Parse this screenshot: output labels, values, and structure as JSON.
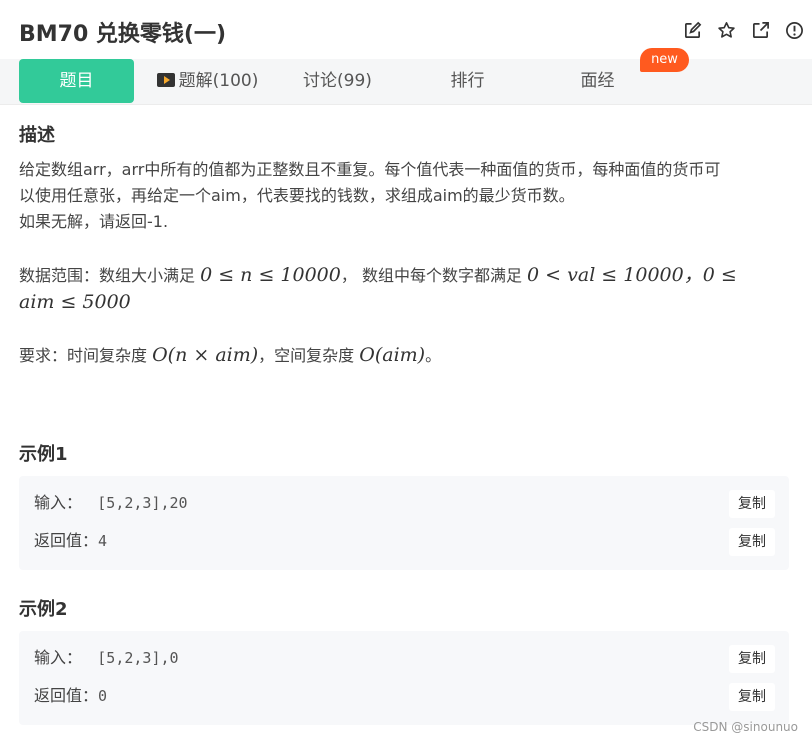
{
  "header": {
    "title": "BM70  兑换零钱(一)",
    "icons": [
      "edit-icon",
      "star-icon",
      "open-external-icon",
      "info-icon"
    ]
  },
  "tabs": [
    {
      "label": "题目",
      "active": true
    },
    {
      "label": "题解(100)",
      "icon": "video-icon"
    },
    {
      "label": "讨论(99)"
    },
    {
      "label": "排行"
    },
    {
      "label": "面经"
    }
  ],
  "new_badge": "new",
  "description": {
    "heading": "描述",
    "line1": "给定数组arr，arr中所有的值都为正整数且不重复。每个值代表一种面值的货币，每种面值的货币可",
    "line2": "以使用任意张，再给定一个aim，代表要找的钱数，求组成aim的最少货币数。",
    "line3": "如果无解，请返回-1.",
    "range_label": "数据范围：数组大小满足 ",
    "range_math1": "0 ≤ n ≤ 10000",
    "range_mid": "， 数组中每个数字都满足 ",
    "range_math2": "0 < val ≤ 10000，0 ≤",
    "range_math3": "aim ≤ 5000",
    "req_label": "要求：时间复杂度 ",
    "req_math1": "O(n × aim)",
    "req_mid": "，空间复杂度 ",
    "req_math2": "O(aim)",
    "req_end": "。"
  },
  "examples": [
    {
      "heading": "示例1",
      "input_label": "输入：",
      "input_value": "[5,2,3],20",
      "output_label": "返回值：",
      "output_value": "4",
      "copy_label": "复制"
    },
    {
      "heading": "示例2",
      "input_label": "输入：",
      "input_value": "[5,2,3],0",
      "output_label": "返回值：",
      "output_value": "0",
      "copy_label": "复制"
    }
  ],
  "watermark": "CSDN @sinounuo",
  "colors": {
    "accent": "#32ca99",
    "badge": "#ff5a1f",
    "example_bg": "#f7f8fa"
  }
}
